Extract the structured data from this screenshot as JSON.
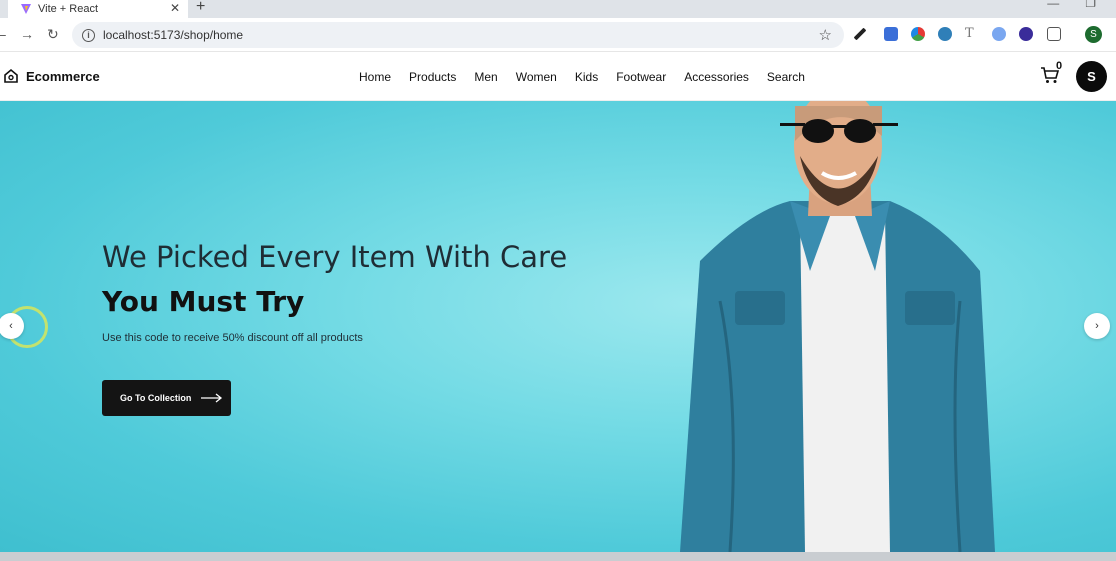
{
  "browser": {
    "tab_title": "Vite + React",
    "tab_close": "✕",
    "new_tab": "+",
    "url": "localhost:5173/shop/home",
    "profile_initial": "S"
  },
  "site": {
    "brand": "Ecommerce",
    "nav": [
      "Home",
      "Products",
      "Men",
      "Women",
      "Kids",
      "Footwear",
      "Accessories",
      "Search"
    ],
    "cart_count": "0",
    "user_initial": "S"
  },
  "hero": {
    "title_line1": "We Picked Every Item With Care",
    "title_line2": "You Must Try",
    "subtitle": "Use this code to receive 50% discount off all products",
    "cta_label": "Go To Collection",
    "prev_icon": "chevron-left-icon",
    "next_icon": "chevron-right-icon"
  },
  "colors": {
    "hero_bg": "#4fcad9",
    "cta_bg": "#141414",
    "avatar_bg": "#0b0b0b"
  }
}
